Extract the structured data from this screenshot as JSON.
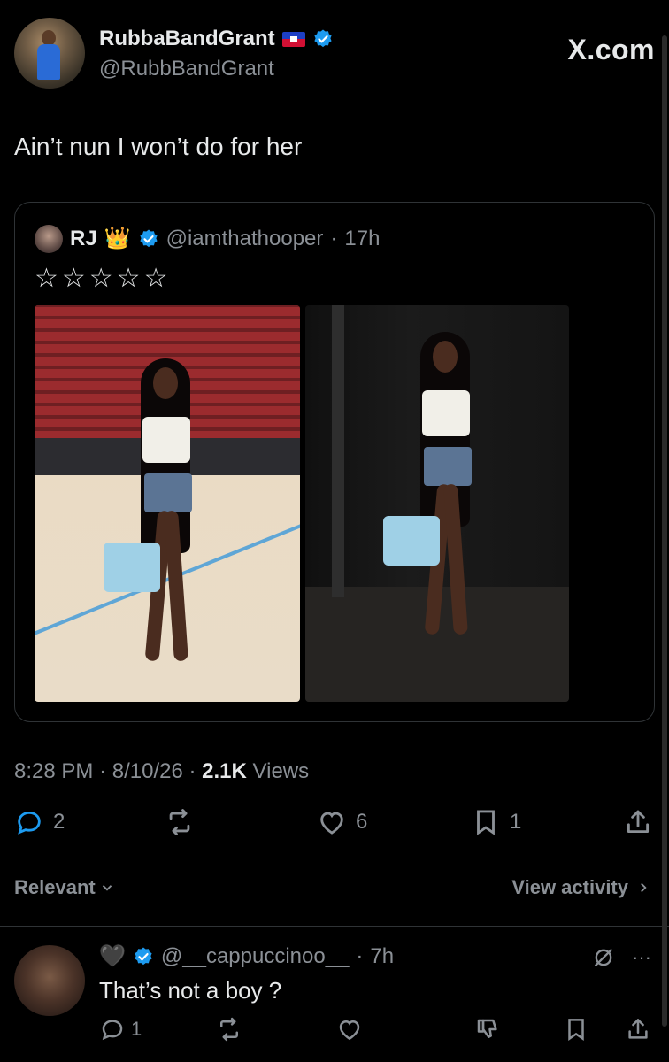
{
  "header": {
    "display_name": "RubbaBandGrant",
    "handle": "@RubbBandGrant",
    "site": "X.com"
  },
  "tweet": {
    "text": "Ain’t nun I won’t do for her",
    "timestamp": "8:28 PM",
    "date": "8/10/26",
    "views_count": "2.1K",
    "views_label": "Views"
  },
  "quote": {
    "name": "RJ",
    "crown": "👑",
    "handle": "@iamthathooper",
    "age": "17h",
    "stars": "☆☆☆☆☆"
  },
  "actions": {
    "replies": "2",
    "likes": "6",
    "bookmarks": "1"
  },
  "filter": {
    "label": "Relevant",
    "view_activity": "View activity"
  },
  "reply": {
    "name_emoji": "🖤",
    "handle": "@__cappuccinoo__",
    "age": "7h",
    "text": "That’s not a boy ?",
    "replies": "1"
  },
  "colors": {
    "background": "#000000",
    "primary_text": "#e7e9ea",
    "secondary_text": "#8b9096",
    "verified": "#1d9bf0",
    "border": "#2f3336"
  }
}
